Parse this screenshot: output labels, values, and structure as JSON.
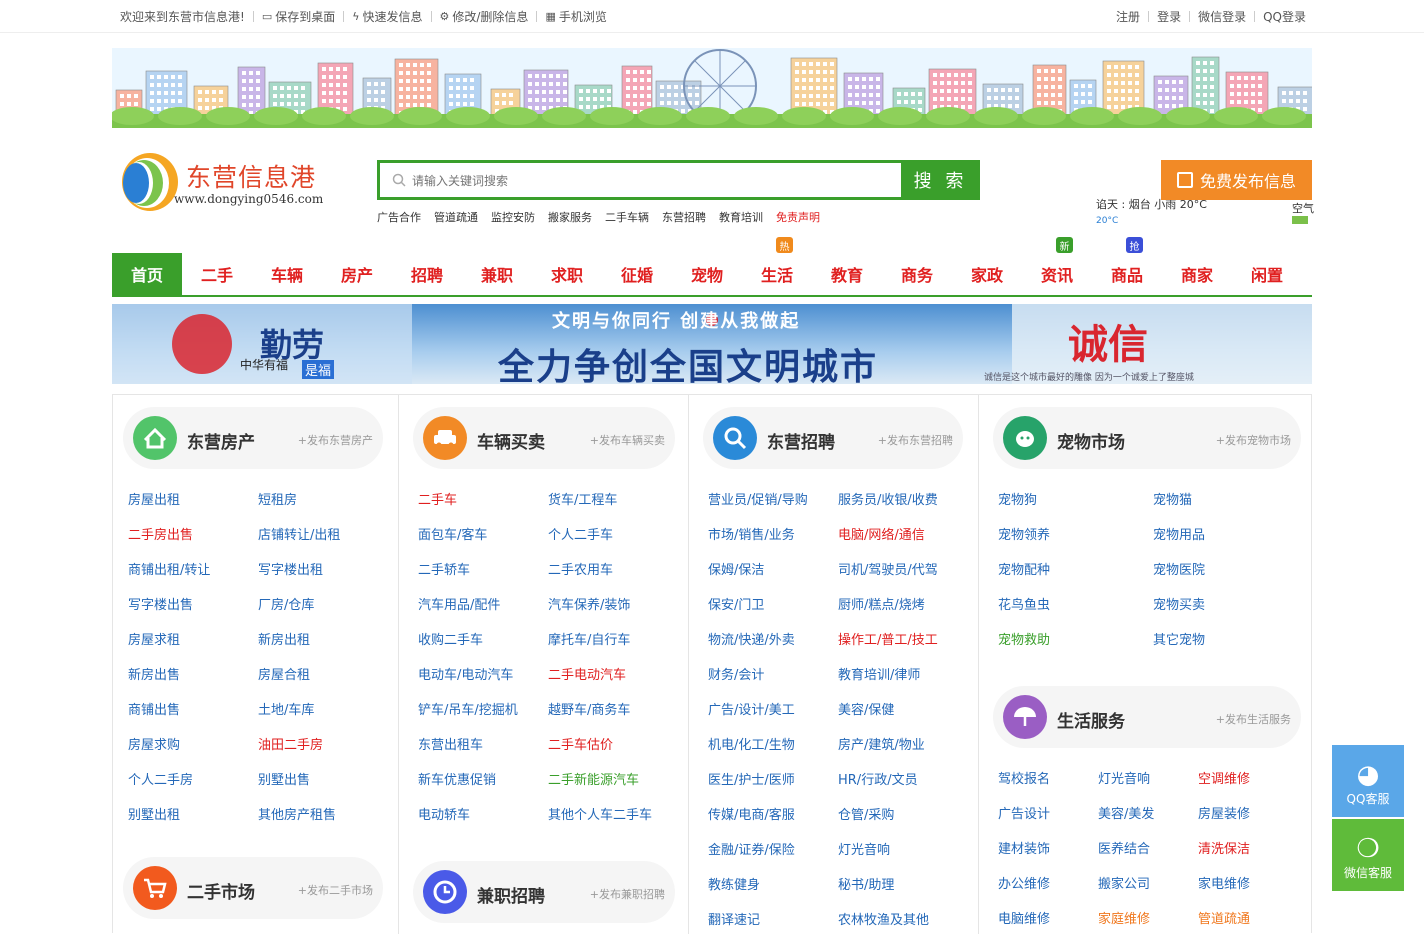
{
  "topbar": {
    "welcome": "欢迎来到东营市信息港!",
    "links": [
      {
        "label": "保存到桌面",
        "icon": "monitor-icon"
      },
      {
        "label": "快速发信息",
        "icon": "lightning-icon"
      },
      {
        "label": "修改/删除信息",
        "icon": "gear-icon"
      },
      {
        "label": "手机浏览",
        "icon": "qrcode-icon"
      }
    ],
    "right": [
      "注册",
      "登录",
      "微信登录",
      "QQ登录"
    ]
  },
  "logo": {
    "name": "东营信息港",
    "url": "www.dongying0546.com"
  },
  "search": {
    "placeholder": "请输入关键词搜索",
    "button": "搜 索"
  },
  "hotwords": [
    {
      "label": "广告合作",
      "style": ""
    },
    {
      "label": "管道疏通",
      "style": ""
    },
    {
      "label": "监控安防",
      "style": ""
    },
    {
      "label": "搬家服务",
      "style": ""
    },
    {
      "label": "二手车辆",
      "style": ""
    },
    {
      "label": "东营招聘",
      "style": ""
    },
    {
      "label": "教育培训",
      "style": ""
    },
    {
      "label": "免责声明",
      "style": "red"
    }
  ],
  "weather": {
    "line1": "谄天 :  烟台      小雨  20°C",
    "line2": "20°C",
    "side": "空气"
  },
  "publish": {
    "label": "免费发布信息"
  },
  "nav": [
    {
      "label": "首页",
      "active": true
    },
    {
      "label": "二手"
    },
    {
      "label": "车辆"
    },
    {
      "label": "房产"
    },
    {
      "label": "招聘"
    },
    {
      "label": "兼职"
    },
    {
      "label": "求职"
    },
    {
      "label": "征婚"
    },
    {
      "label": "宠物"
    },
    {
      "label": "生活",
      "badge": "热",
      "badge_color": "#f08a1c"
    },
    {
      "label": "教育"
    },
    {
      "label": "商务"
    },
    {
      "label": "家政"
    },
    {
      "label": "资讯",
      "badge": "新",
      "badge_color": "#3a9f2b"
    },
    {
      "label": "商品",
      "badge": "抢",
      "badge_color": "#3b4fd8"
    },
    {
      "label": "商家"
    },
    {
      "label": "闲置"
    }
  ],
  "banner2": {
    "left_big": "勤劳",
    "left_small": "中华有福",
    "left_sub": "是福",
    "top_line": "文明与你同行 创建从我做起",
    "main_line": "全力争创全国文明城市",
    "right_big": "诚信",
    "right_caption": "诚信是这个城市最好的雕像   因为一个诚爱上了整座城"
  },
  "sections": {
    "house": {
      "title": "东营房产",
      "publish": "+发布东营房产",
      "links": [
        {
          "label": "房屋出租"
        },
        {
          "label": "短租房"
        },
        {
          "label": "二手房出售",
          "style": "red"
        },
        {
          "label": "店铺转让/出租"
        },
        {
          "label": "商铺出租/转让"
        },
        {
          "label": "写字楼出租"
        },
        {
          "label": "写字楼出售"
        },
        {
          "label": "厂房/仓库"
        },
        {
          "label": "房屋求租"
        },
        {
          "label": "新房出租"
        },
        {
          "label": "新房出售"
        },
        {
          "label": "房屋合租"
        },
        {
          "label": "商铺出售"
        },
        {
          "label": "土地/车库"
        },
        {
          "label": "房屋求购"
        },
        {
          "label": "油田二手房",
          "style": "red"
        },
        {
          "label": "个人二手房"
        },
        {
          "label": "别墅出售"
        },
        {
          "label": "别墅出租"
        },
        {
          "label": "其他房产租售"
        }
      ]
    },
    "secondhand": {
      "title": "二手市场",
      "publish": "+发布二手市场"
    },
    "car": {
      "title": "车辆买卖",
      "publish": "+发布车辆买卖",
      "links": [
        {
          "label": "二手车",
          "style": "red"
        },
        {
          "label": "货车/工程车"
        },
        {
          "label": "面包车/客车"
        },
        {
          "label": "个人二手车"
        },
        {
          "label": "二手轿车"
        },
        {
          "label": "二手农用车"
        },
        {
          "label": "汽车用品/配件"
        },
        {
          "label": "汽车保养/装饰"
        },
        {
          "label": "收购二手车"
        },
        {
          "label": "摩托车/自行车"
        },
        {
          "label": "电动车/电动汽车"
        },
        {
          "label": "二手电动汽车",
          "style": "red"
        },
        {
          "label": "铲车/吊车/挖掘机"
        },
        {
          "label": "越野车/商务车"
        },
        {
          "label": "东营出租车"
        },
        {
          "label": "二手车估价",
          "style": "red"
        },
        {
          "label": "新车优惠促销"
        },
        {
          "label": "二手新能源汽车",
          "style": "green"
        },
        {
          "label": "电动轿车"
        },
        {
          "label": "其他个人车二手车"
        }
      ]
    },
    "parttime": {
      "title": "兼职招聘",
      "publish": "+发布兼职招聘"
    },
    "job": {
      "title": "东营招聘",
      "publish": "+发布东营招聘",
      "links": [
        {
          "label": "营业员/促销/导购"
        },
        {
          "label": "服务员/收银/收费"
        },
        {
          "label": "市场/销售/业务"
        },
        {
          "label": "电脑/网络/通信",
          "style": "red"
        },
        {
          "label": "保姆/保洁"
        },
        {
          "label": "司机/驾驶员/代驾"
        },
        {
          "label": "保安/门卫"
        },
        {
          "label": "厨师/糕点/烧烤"
        },
        {
          "label": "物流/快递/外卖"
        },
        {
          "label": "操作工/普工/技工",
          "style": "red"
        },
        {
          "label": "财务/会计"
        },
        {
          "label": "教育培训/律师"
        },
        {
          "label": "广告/设计/美工"
        },
        {
          "label": "美容/保健"
        },
        {
          "label": "机电/化工/生物"
        },
        {
          "label": "房产/建筑/物业"
        },
        {
          "label": "医生/护士/医师"
        },
        {
          "label": "HR/行政/文员"
        },
        {
          "label": "传媒/电商/客服"
        },
        {
          "label": "仓管/采购"
        },
        {
          "label": "金融/证券/保险"
        },
        {
          "label": "灯光音响"
        },
        {
          "label": "教练健身"
        },
        {
          "label": "秘书/助理"
        },
        {
          "label": "翻译速记"
        },
        {
          "label": "农林牧渔及其他"
        }
      ]
    },
    "pet": {
      "title": "宠物市场",
      "publish": "+发布宠物市场",
      "links": [
        {
          "label": "宠物狗"
        },
        {
          "label": "宠物猫"
        },
        {
          "label": "宠物领养"
        },
        {
          "label": "宠物用品"
        },
        {
          "label": "宠物配种"
        },
        {
          "label": "宠物医院"
        },
        {
          "label": "花鸟鱼虫"
        },
        {
          "label": "宠物买卖"
        },
        {
          "label": "宠物救助",
          "style": "green"
        },
        {
          "label": "其它宠物"
        }
      ]
    },
    "life": {
      "title": "生活服务",
      "publish": "+发布生活服务",
      "links": [
        {
          "label": "驾校报名"
        },
        {
          "label": "灯光音响"
        },
        {
          "label": "空调维修",
          "style": "red"
        },
        {
          "label": "广告设计"
        },
        {
          "label": "美容/美发"
        },
        {
          "label": "房屋装修"
        },
        {
          "label": "建材装饰"
        },
        {
          "label": "医养结合"
        },
        {
          "label": "清洗保洁",
          "style": "red"
        },
        {
          "label": "办公维修"
        },
        {
          "label": "搬家公司"
        },
        {
          "label": "家电维修"
        },
        {
          "label": "电脑维修"
        },
        {
          "label": "家庭维修",
          "style": "orange"
        },
        {
          "label": "管道疏通",
          "style": "orange"
        }
      ]
    }
  },
  "float": {
    "qq": "QQ客服",
    "wechat": "微信客服"
  },
  "colors": {
    "green": "#3a9f2b",
    "red": "#e02020",
    "blue": "#2468b8",
    "orange": "#f28a26"
  }
}
